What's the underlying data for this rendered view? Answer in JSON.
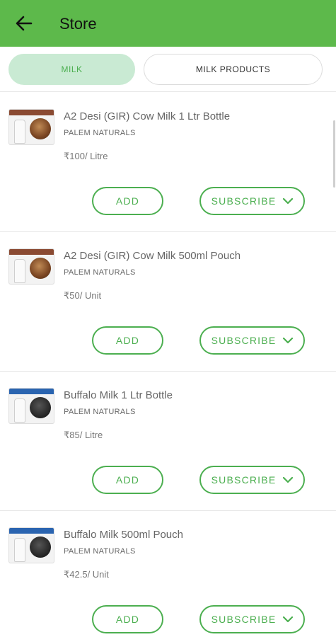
{
  "appbar": {
    "title": "Store",
    "back_icon": "arrow-left-icon",
    "bg": "#5db94b"
  },
  "tabs": [
    {
      "label": "MILK",
      "active": true
    },
    {
      "label": "MILK PRODUCTS",
      "active": false
    }
  ],
  "products": [
    {
      "name": "A2 Desi (GIR) Cow Milk 1 Ltr Bottle",
      "brand": "PALEM NATURALS",
      "price": "₹100/ Litre",
      "add_label": "ADD",
      "subscribe_label": "SUBSCRIBE",
      "thumb_color": "#8a4a32",
      "animal": "cow"
    },
    {
      "name": "A2 Desi (GIR) Cow Milk 500ml Pouch",
      "brand": "PALEM NATURALS",
      "price": "₹50/ Unit",
      "add_label": "ADD",
      "subscribe_label": "SUBSCRIBE",
      "thumb_color": "#8a4a32",
      "animal": "cow"
    },
    {
      "name": "Buffalo Milk 1 Ltr Bottle",
      "brand": "PALEM NATURALS",
      "price": "₹85/ Litre",
      "add_label": "ADD",
      "subscribe_label": "SUBSCRIBE",
      "thumb_color": "#2a64b0",
      "animal": "buffalo"
    },
    {
      "name": "Buffalo Milk 500ml Pouch",
      "brand": "PALEM NATURALS",
      "price": "₹42.5/ Unit",
      "add_label": "ADD",
      "subscribe_label": "SUBSCRIBE",
      "thumb_color": "#2a64b0",
      "animal": "buffalo"
    }
  ],
  "colors": {
    "accent": "#4caf50",
    "tab_active_bg": "#c9ead3"
  }
}
